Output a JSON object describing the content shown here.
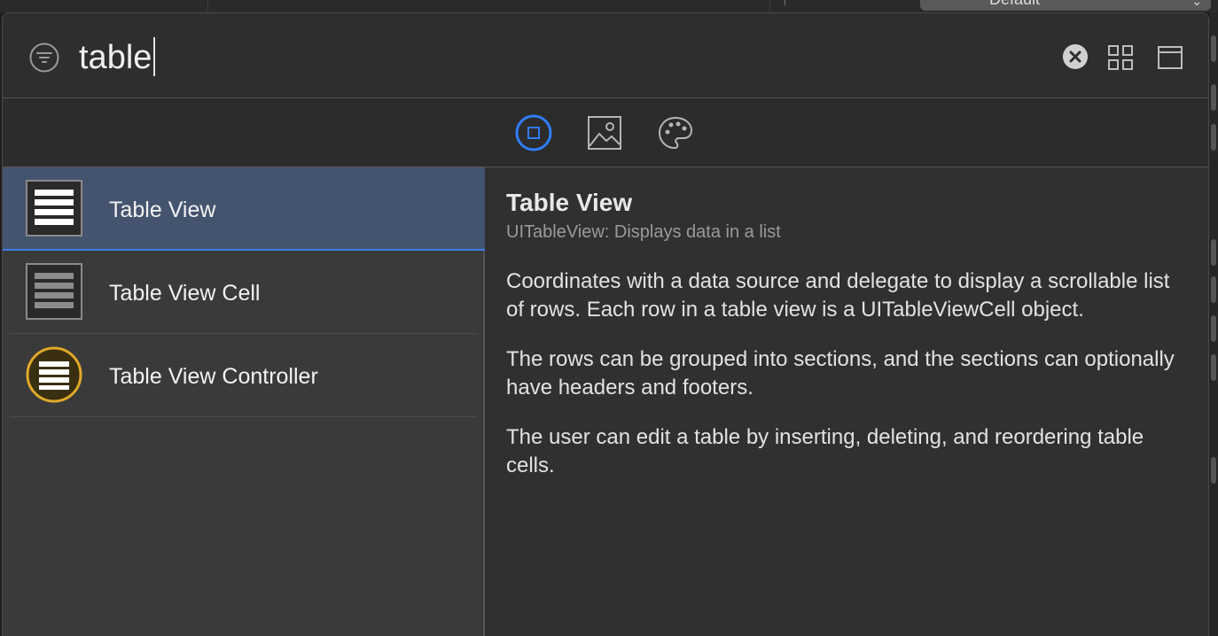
{
  "background": {
    "popup_label": "Default"
  },
  "search": {
    "query": "table",
    "filter_icon": "filter-icon",
    "clear_icon": "clear-icon",
    "grid_icon": "grid-view-icon",
    "panel_icon": "panel-view-icon"
  },
  "tabs": [
    {
      "name": "objects",
      "icon": "object-library-icon",
      "selected": true
    },
    {
      "name": "media",
      "icon": "media-library-icon",
      "selected": false
    },
    {
      "name": "colors",
      "icon": "color-palette-icon",
      "selected": false
    }
  ],
  "results": [
    {
      "label": "Table View",
      "icon": "table-view-icon",
      "selected": true
    },
    {
      "label": "Table View Cell",
      "icon": "table-view-cell-icon",
      "selected": false
    },
    {
      "label": "Table View Controller",
      "icon": "table-view-controller-icon",
      "selected": false
    }
  ],
  "detail": {
    "title": "Table View",
    "subtitle": "UITableView: Displays data in a list",
    "paragraphs": [
      "Coordinates with a data source and delegate to display a scrollable list of rows. Each row in a table view is a UITableViewCell object.",
      "The rows can be grouped into sections, and the sections can optionally have headers and footers.",
      "The user can edit a table by inserting, deleting, and reordering table cells."
    ]
  },
  "colors": {
    "accent": "#2f7cf6",
    "selection": "#44546e",
    "controller_badge": "#e0a92a"
  }
}
